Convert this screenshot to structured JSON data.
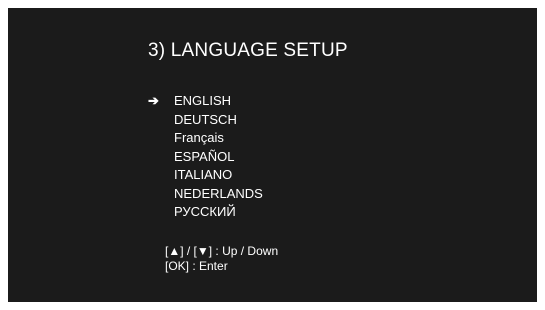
{
  "screen": {
    "title": "3) LANGUAGE SETUP",
    "cursor_glyph": "➔",
    "selected_index": 0,
    "languages": [
      {
        "label": "ENGLISH"
      },
      {
        "label": "DEUTSCH"
      },
      {
        "label": "Français"
      },
      {
        "label": "ESPAÑOL"
      },
      {
        "label": "ITALIANO"
      },
      {
        "label": "NEDERLANDS"
      },
      {
        "label": "РУССКИЙ"
      }
    ],
    "help": {
      "navigate": "[▲] / [▼] :  Up / Down",
      "enter": "[OK] :  Enter"
    }
  },
  "colors": {
    "background": "#1b1b1b",
    "text": "#ffffff"
  }
}
